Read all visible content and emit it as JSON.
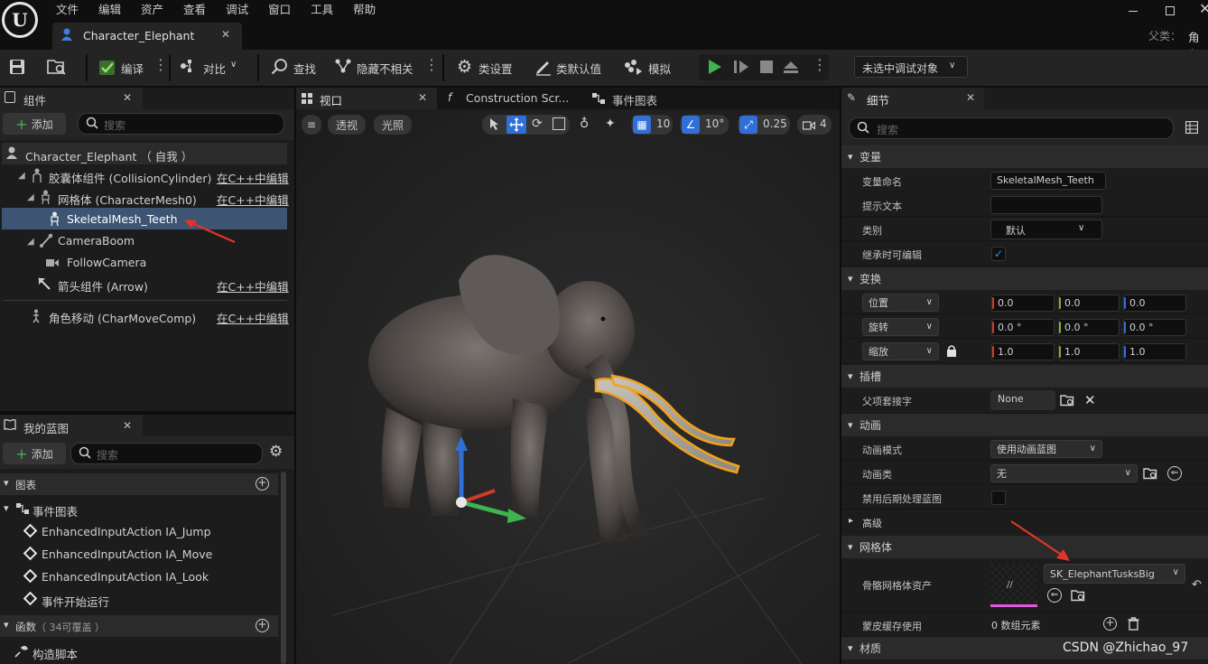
{
  "menu": [
    "文件",
    "编辑",
    "资产",
    "查看",
    "调试",
    "窗口",
    "工具",
    "帮助"
  ],
  "doc_tab": "Character_Elephant",
  "parent_label": "父类：",
  "parent_value": "角色",
  "toolbar": {
    "compile": "编译",
    "diff": "对比",
    "find": "查找",
    "hide_unrelated": "隐藏不相关",
    "class_settings": "类设置",
    "class_defaults": "类默认值",
    "simulate": "模拟",
    "debug_target": "未选中调试对象"
  },
  "components": {
    "tab": "组件",
    "add": "添加",
    "search_placeholder": "搜索",
    "root": "Character_Elephant （ 自我 ）",
    "items": [
      {
        "label": "胶囊体组件 (CollisionCylinder)",
        "link": "在C++中编辑"
      },
      {
        "label": "网格体 (CharacterMesh0)",
        "link": "在C++中编辑"
      },
      {
        "label": "SkeletalMesh_Teeth",
        "link": ""
      },
      {
        "label": "CameraBoom",
        "link": ""
      },
      {
        "label": "FollowCamera",
        "link": ""
      },
      {
        "label": "箭头组件 (Arrow)",
        "link": "在C++中编辑"
      },
      {
        "label": "角色移动 (CharMoveComp)",
        "link": "在C++中编辑"
      }
    ]
  },
  "my_blueprint": {
    "tab": "我的蓝图",
    "add": "添加",
    "search_placeholder": "搜索",
    "graphs_header": "图表",
    "event_graph": "事件图表",
    "events": [
      "EnhancedInputAction IA_Jump",
      "EnhancedInputAction IA_Move",
      "EnhancedInputAction IA_Look",
      "事件开始运行"
    ],
    "functions_header": "函数",
    "functions_count": "（ 34可覆盖 ）",
    "construct_script": "构造脚本"
  },
  "viewport": {
    "tabs": [
      "视口",
      "Construction Scr...",
      "事件图表"
    ],
    "perspective": "透视",
    "lighting": "光照",
    "grid_snap": "10",
    "rot_snap": "10°",
    "scale_snap": "0.25",
    "cam_speed": "4"
  },
  "details": {
    "tab": "细节",
    "search_placeholder": "搜索",
    "sections": {
      "variable": "变量",
      "transform": "变换",
      "sockets": "插槽",
      "animation": "动画",
      "advanced": "高级",
      "mesh": "网格体",
      "materials": "材质"
    },
    "var_name_label": "变量命名",
    "var_name_value": "SkeletalMesh_Teeth",
    "tooltip_label": "提示文本",
    "tooltip_value": "",
    "category_label": "类别",
    "category_value": "默认",
    "editable_label": "继承时可编辑",
    "location_label": "位置",
    "rotation_label": "旋转",
    "scale_label": "缩放",
    "location": [
      "0.0",
      "0.0",
      "0.0"
    ],
    "rotation": [
      "0.0 °",
      "0.0 °",
      "0.0 °"
    ],
    "scale": [
      "1.0",
      "1.0",
      "1.0"
    ],
    "parent_socket_label": "父项套接字",
    "parent_socket_value": "None",
    "anim_mode_label": "动画模式",
    "anim_mode_value": "使用动画蓝图",
    "anim_class_label": "动画类",
    "anim_class_value": "无",
    "disable_post_label": "禁用后期处理蓝图",
    "skel_mesh_label": "骨骼网格体资产",
    "skel_mesh_value": "SK_ElephantTusksBig",
    "skin_cache_label": "蒙皮缓存使用",
    "skin_cache_value": "0 数组元素"
  },
  "watermark": "CSDN @Zhichao_97",
  "colors": {
    "accent": "#2f6fd6",
    "selection": "#3d5573",
    "play_green": "#3fb34f",
    "arrow_red": "#e0342a"
  }
}
